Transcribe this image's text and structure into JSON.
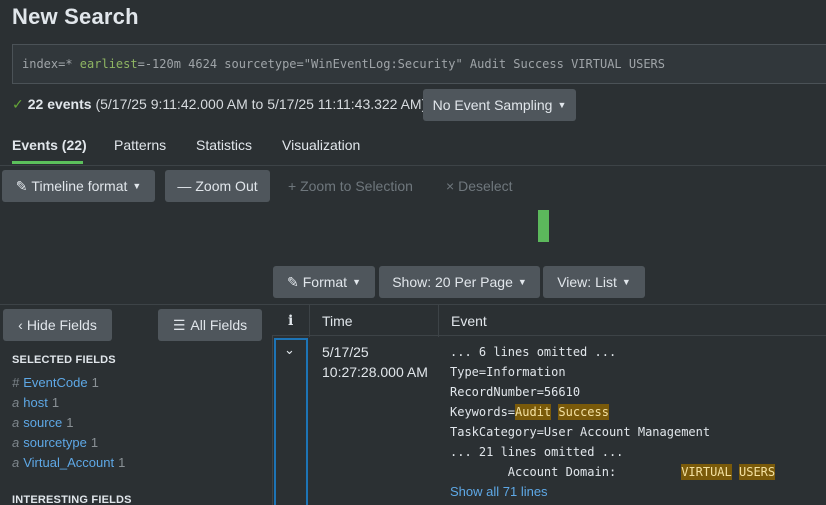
{
  "page_title": "New Search",
  "search": {
    "query_parts": [
      {
        "text": "index=* ",
        "style": "kw"
      },
      {
        "text": "earliest",
        "style": "kw-green"
      },
      {
        "text": "=-120m 4624 sourcetype=\"WinEventLog:Security\" Audit Success VIRTUAL USERS",
        "style": "kw"
      }
    ]
  },
  "status": {
    "check_icon": "✓",
    "count_label": "22 events",
    "range": "(5/17/25 9:11:42.000 AM to 5/17/25 11:11:43.322 AM)",
    "sampling_button": "No Event Sampling"
  },
  "tabs": [
    {
      "label": "Events (22)",
      "active": true
    },
    {
      "label": "Patterns",
      "active": false
    },
    {
      "label": "Statistics",
      "active": false
    },
    {
      "label": "Visualization",
      "active": false
    }
  ],
  "timeline": {
    "format_button": "Timeline format",
    "zoom_out_button": "Zoom Out",
    "zoom_to_selection": "Zoom to Selection",
    "deselect": "Deselect"
  },
  "toolbar": {
    "format_button": "Format",
    "per_page_button": "Show: 20 Per Page",
    "view_button": "View: List"
  },
  "sidebar": {
    "hide_fields_button": "Hide Fields",
    "all_fields_button": "All Fields",
    "selected_heading": "SELECTED FIELDS",
    "selected_fields": [
      {
        "type": "#",
        "name": "EventCode",
        "count": "1"
      },
      {
        "type": "a",
        "name": "host",
        "count": "1"
      },
      {
        "type": "a",
        "name": "source",
        "count": "1"
      },
      {
        "type": "a",
        "name": "sourcetype",
        "count": "1"
      },
      {
        "type": "a",
        "name": "Virtual_Account",
        "count": "1"
      }
    ],
    "interesting_heading": "INTERESTING FIELDS"
  },
  "table": {
    "col_info": "i",
    "col_time": "Time",
    "col_event": "Event",
    "row": {
      "date": "5/17/25",
      "time": "10:27:28.000 AM",
      "lines": [
        "... 6 lines omitted ...",
        "Type=Information",
        "RecordNumber=56610",
        "Keywords=",
        "TaskCategory=User Account Management",
        "... 21 lines omitted ...",
        "        Account Domain:         "
      ],
      "hl_audit": "Audit",
      "hl_success": "Success",
      "hl_virtual": "VIRTUAL",
      "hl_users": "USERS",
      "show_all": "Show all 71 lines"
    }
  },
  "colors": {
    "accent_green": "#5cc05c",
    "link_blue": "#5ea8e6",
    "highlight": "#7a5a0a"
  }
}
